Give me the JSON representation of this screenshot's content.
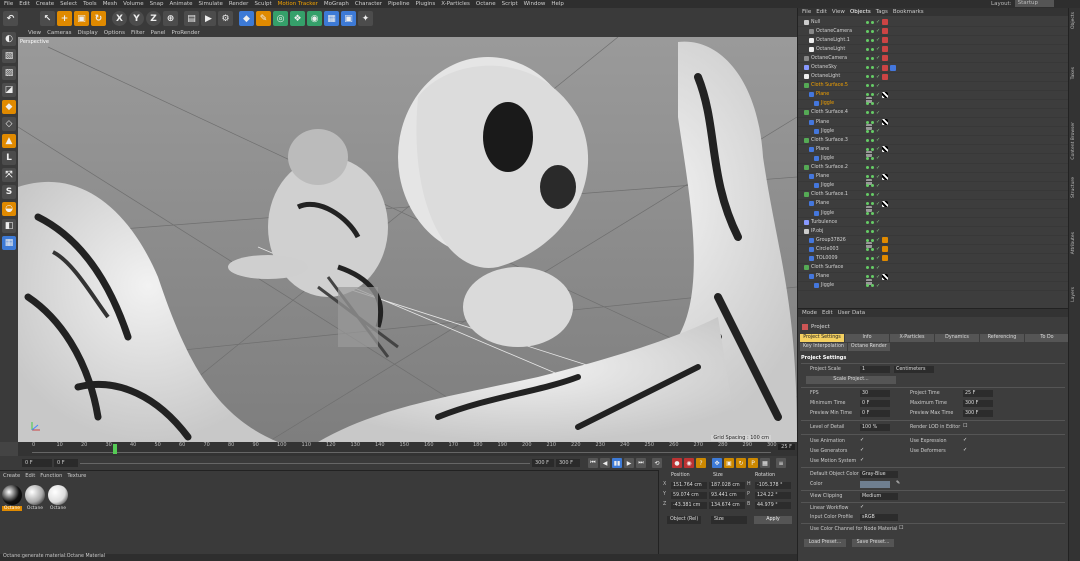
{
  "menu": {
    "items": [
      "File",
      "Edit",
      "Create",
      "Select",
      "Tools",
      "Mesh",
      "Volume",
      "Snap",
      "Animate",
      "Simulate",
      "Render",
      "Sculpt",
      "Motion Tracker",
      "MoGraph",
      "Character",
      "Pipeline",
      "Plugins",
      "X-Particles",
      "Octane",
      "Script",
      "Window",
      "Help"
    ],
    "layout_label": "Layout:",
    "layout_value": "Startup"
  },
  "viewport": {
    "menu": [
      "View",
      "Cameras",
      "Display",
      "Options",
      "Filter",
      "Panel",
      "ProRender"
    ],
    "label": "Perspective",
    "grid_spacing": "Grid Spacing : 100 cm"
  },
  "timeline": {
    "ticks": [
      "0",
      "10",
      "20",
      "30",
      "40",
      "50",
      "60",
      "70",
      "80",
      "90",
      "100",
      "110",
      "120",
      "130",
      "140",
      "150",
      "160",
      "170",
      "180",
      "190",
      "200",
      "210",
      "220",
      "230",
      "240",
      "250",
      "260",
      "270",
      "280",
      "290",
      "300"
    ],
    "end_frame": "25 F",
    "current_frame_pct": 0.11
  },
  "transport": {
    "start": "0 F",
    "start2": "0 F",
    "end": "300 F",
    "end2": "300 F"
  },
  "materials": {
    "menu": [
      "Create",
      "Edit",
      "Function",
      "Texture"
    ],
    "items": [
      {
        "name": "Octane",
        "color": "#111111",
        "selected": true
      },
      {
        "name": "Octane",
        "color": "#aaaaaa",
        "selected": false
      },
      {
        "name": "Octane",
        "color": "#dddddd",
        "selected": false
      }
    ]
  },
  "coordinates": {
    "headers": [
      "Position",
      "Size",
      "Rotation"
    ],
    "rows": [
      {
        "axis": "X",
        "pos": "151.764 cm",
        "size": "187.028 cm",
        "rot_axis": "H",
        "rot": "-105.378 °"
      },
      {
        "axis": "Y",
        "pos": "59.074 cm",
        "size": "93.441 cm",
        "rot_axis": "P",
        "rot": "124.22 °"
      },
      {
        "axis": "Z",
        "pos": "-43.381 cm",
        "size": "134.674 cm",
        "rot_axis": "B",
        "rot": "44.979 °"
      }
    ],
    "mode": "Object (Rel)",
    "size_mode": "Size",
    "apply": "Apply"
  },
  "status": "Octane:generate material:Octane Material",
  "objects": {
    "menu": [
      "File",
      "Edit",
      "View",
      "Objects",
      "Tags",
      "Bookmarks"
    ],
    "active_menu": "Objects",
    "rows": [
      {
        "name": "Null",
        "indent": 0,
        "icon": "#cccccc",
        "selected": false,
        "tags": [
          "cam"
        ]
      },
      {
        "name": "OctaneCamera",
        "indent": 1,
        "icon": "#888888",
        "selected": false,
        "tags": [
          "cam"
        ]
      },
      {
        "name": "OctaneLight.1",
        "indent": 1,
        "icon": "#eeeeee",
        "selected": false,
        "tags": [
          "cam"
        ]
      },
      {
        "name": "OctaneLight",
        "indent": 1,
        "icon": "#eeeeee",
        "selected": false,
        "tags": [
          "cam"
        ]
      },
      {
        "name": "OctaneCamera",
        "indent": 0,
        "icon": "#888888",
        "selected": false,
        "tags": [
          "cam"
        ]
      },
      {
        "name": "OctaneSky",
        "indent": 0,
        "icon": "#8899ff",
        "selected": false,
        "tags": [
          "cam",
          "blue"
        ]
      },
      {
        "name": "OctaneLight",
        "indent": 0,
        "icon": "#eeeeee",
        "selected": false,
        "tags": [
          "cam"
        ]
      },
      {
        "name": "Cloth Surface.5",
        "indent": 0,
        "icon": "#55aa55",
        "selected": true,
        "tags": [
          "mat"
        ]
      },
      {
        "name": "Plane",
        "indent": 1,
        "icon": "#4477dd",
        "selected": true,
        "tags": [
          "chk"
        ]
      },
      {
        "name": "Jiggle",
        "indent": 2,
        "icon": "#4477dd",
        "selected": true,
        "tags": []
      },
      {
        "name": "Cloth Surface.4",
        "indent": 0,
        "icon": "#55aa55",
        "selected": false,
        "tags": [
          "mat"
        ]
      },
      {
        "name": "Plane",
        "indent": 1,
        "icon": "#4477dd",
        "selected": false,
        "tags": [
          "chk"
        ]
      },
      {
        "name": "Jiggle",
        "indent": 2,
        "icon": "#4477dd",
        "selected": false,
        "tags": []
      },
      {
        "name": "Cloth Surface.3",
        "indent": 0,
        "icon": "#55aa55",
        "selected": false,
        "tags": [
          "mat"
        ]
      },
      {
        "name": "Plane",
        "indent": 1,
        "icon": "#4477dd",
        "selected": false,
        "tags": [
          "chk"
        ]
      },
      {
        "name": "Jiggle",
        "indent": 2,
        "icon": "#4477dd",
        "selected": false,
        "tags": []
      },
      {
        "name": "Cloth Surface.2",
        "indent": 0,
        "icon": "#55aa55",
        "selected": false,
        "tags": [
          "mat"
        ]
      },
      {
        "name": "Plane",
        "indent": 1,
        "icon": "#4477dd",
        "selected": false,
        "tags": [
          "chk"
        ]
      },
      {
        "name": "Jiggle",
        "indent": 2,
        "icon": "#4477dd",
        "selected": false,
        "tags": []
      },
      {
        "name": "Cloth Surface.1",
        "indent": 0,
        "icon": "#55aa55",
        "selected": false,
        "tags": [
          "mat"
        ]
      },
      {
        "name": "Plane",
        "indent": 1,
        "icon": "#4477dd",
        "selected": false,
        "tags": [
          "chk"
        ]
      },
      {
        "name": "Jiggle",
        "indent": 2,
        "icon": "#4477dd",
        "selected": false,
        "tags": []
      },
      {
        "name": "Turbulence",
        "indent": 0,
        "icon": "#8899ff",
        "selected": false,
        "tags": []
      },
      {
        "name": "IP.obj",
        "indent": 0,
        "icon": "#cccccc",
        "selected": false,
        "tags": [
          "mat"
        ]
      },
      {
        "name": "Group37826",
        "indent": 1,
        "icon": "#4477dd",
        "selected": false,
        "tags": [
          "orange"
        ]
      },
      {
        "name": "Circle003",
        "indent": 1,
        "icon": "#4477dd",
        "selected": false,
        "tags": [
          "orange"
        ]
      },
      {
        "name": "TOL0009",
        "indent": 1,
        "icon": "#4477dd",
        "selected": false,
        "tags": [
          "orange"
        ]
      },
      {
        "name": "Cloth Surface",
        "indent": 0,
        "icon": "#55aa55",
        "selected": false,
        "tags": [
          "mat"
        ]
      },
      {
        "name": "Plane",
        "indent": 1,
        "icon": "#4477dd",
        "selected": false,
        "tags": [
          "chk"
        ]
      },
      {
        "name": "Jiggle",
        "indent": 2,
        "icon": "#4477dd",
        "selected": false,
        "tags": []
      }
    ]
  },
  "attributes": {
    "menu": [
      "Mode",
      "Edit",
      "User Data"
    ],
    "title": "Project",
    "tabs": [
      "Project Settings",
      "Info",
      "X-Particles",
      "Dynamics",
      "Referencing",
      "To Do"
    ],
    "tabs2": [
      "Key Interpolation",
      "Octane Render"
    ],
    "section": "Project Settings",
    "project_scale_label": "Project Scale",
    "project_scale_value": "1",
    "project_scale_unit": "Centimeters",
    "scale_project_btn": "Scale Project...",
    "fps_label": "FPS",
    "fps_value": "30",
    "project_time_label": "Project Time",
    "project_time_value": "25 F",
    "min_time_label": "Minimum Time",
    "min_time_value": "0 F",
    "max_time_label": "Maximum Time",
    "max_time_value": "300 F",
    "prev_min_label": "Preview Min Time",
    "prev_min_value": "0 F",
    "prev_max_label": "Preview Max Time",
    "prev_max_value": "300 F",
    "lod_label": "Level of Detail",
    "lod_value": "100 %",
    "render_lod_label": "Render LOD in Editor",
    "use_animation": "Use Animation",
    "use_expression": "Use Expression",
    "use_generators": "Use Generators",
    "use_deformers": "Use Deformers",
    "use_motion": "Use Motion System",
    "default_color_label": "Default Object Color",
    "default_color_value": "Gray-Blue",
    "color_label": "Color",
    "view_clipping_label": "View Clipping",
    "view_clipping_value": "Medium",
    "linear_workflow": "Linear Workflow",
    "input_color_label": "Input Color Profile",
    "input_color_value": "sRGB",
    "use_color_channel": "Use Color Channel for Node Material",
    "load_preset": "Load Preset...",
    "save_preset": "Save Preset..."
  },
  "side_tabs": [
    "Objects",
    "Takes",
    "Content Browser",
    "Structure",
    "Attributes",
    "Layers"
  ]
}
